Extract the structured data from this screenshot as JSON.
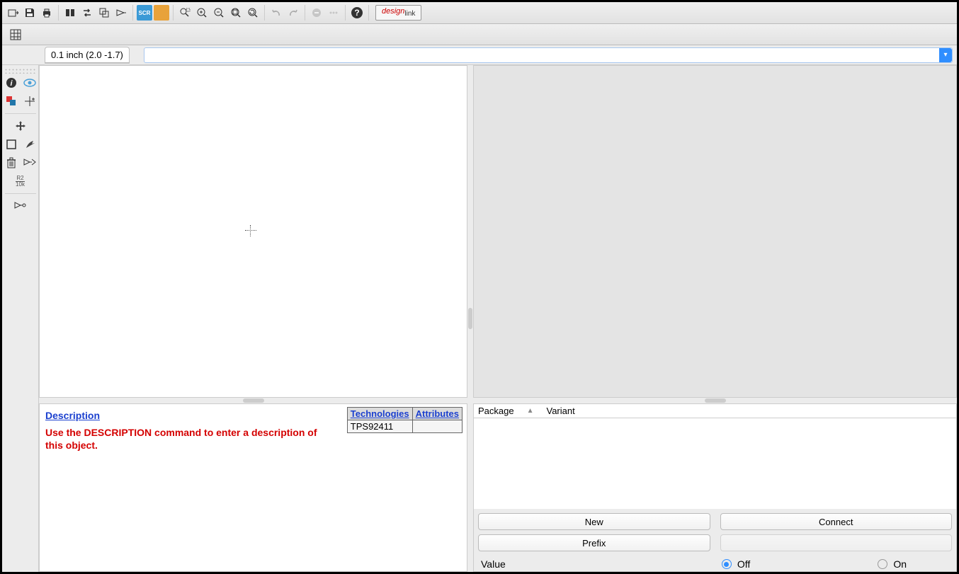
{
  "toolbar": {
    "designlink": "design",
    "designlink_sub": "link"
  },
  "coords_label": "0.1 inch (2.0 -1.7)",
  "description": {
    "heading": "Description",
    "body": "Use the DESCRIPTION command to enter a description of this object."
  },
  "tech_table": {
    "col_technologies": "Technologies",
    "col_attributes": "Attributes",
    "row0_tech": "TPS92411",
    "row0_attr": ""
  },
  "package_panel": {
    "col_package": "Package",
    "col_variant": "Variant",
    "btn_new": "New",
    "btn_connect": "Connect",
    "btn_prefix": "Prefix",
    "value_label": "Value",
    "radio_off": "Off",
    "radio_on": "On",
    "value_selected": "off"
  }
}
